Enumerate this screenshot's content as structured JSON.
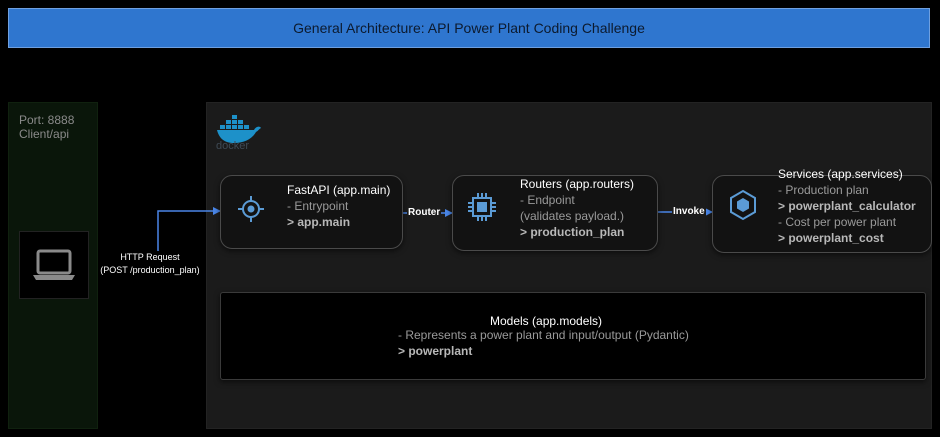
{
  "title": "General Architecture: API Power Plant Coding Challenge",
  "client": {
    "port": "Port: 8888",
    "path": "Client/api"
  },
  "docker": {
    "logo_text": "docker"
  },
  "http_request": {
    "line1": "HTTP Request",
    "line2": "(POST /production_plan)"
  },
  "fastapi": {
    "title": "FastAPI (app.main)",
    "line1": "- Entrypoint",
    "line2": "> app.main"
  },
  "routers": {
    "title": "Routers (app.routers)",
    "line1": "- Endpoint",
    "line2": "(validates payload.)",
    "line3": "> production_plan"
  },
  "services": {
    "title": "Services (app.services)",
    "line1": "- Production plan",
    "line2": "> powerplant_calculator",
    "line3": "- Cost per power plant",
    "line4": "> powerplant_cost"
  },
  "models": {
    "title": "Models (app.models)",
    "line1": "- Represents a power plant and input/output (Pydantic)",
    "line2": "> powerplant"
  },
  "edges": {
    "router_label": "Router",
    "invoke_label": "Invoke"
  },
  "colors": {
    "title_bar": "#2f76cf",
    "arrow": "#4a86e8",
    "docker_blue": "#1d91c9",
    "icon_blue": "#5b9bd5"
  },
  "icons": {
    "client": "laptop-icon",
    "docker": "docker-whale-icon",
    "fastapi": "gear-target-icon",
    "routers": "chip-icon",
    "services": "cube-icon"
  }
}
